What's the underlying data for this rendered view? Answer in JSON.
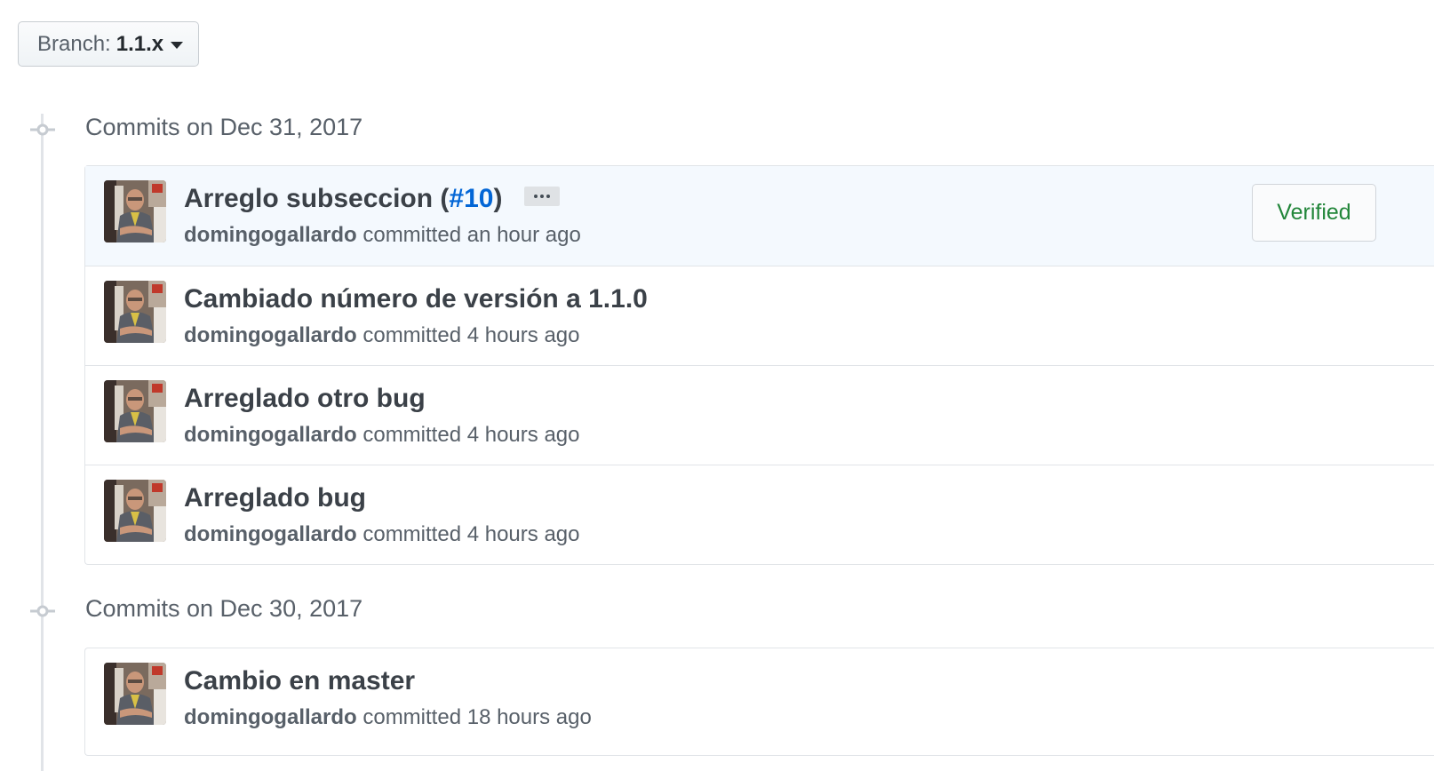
{
  "branch": {
    "prefix": "Branch:",
    "name": "1.1.x"
  },
  "groups": [
    {
      "title": "Commits on Dec 31, 2017",
      "commits": [
        {
          "title": "Arreglo subseccion (",
          "pr": "#10",
          "title_suffix": ")",
          "author": "domingogallardo",
          "action": "committed",
          "time": "an hour ago",
          "verified": "Verified"
        },
        {
          "title": "Cambiado número de versión a 1.1.0",
          "author": "domingogallardo",
          "action": "committed",
          "time": "4 hours ago"
        },
        {
          "title": "Arreglado otro bug",
          "author": "domingogallardo",
          "action": "committed",
          "time": "4 hours ago"
        },
        {
          "title": "Arreglado bug",
          "author": "domingogallardo",
          "action": "committed",
          "time": "4 hours ago"
        }
      ]
    },
    {
      "title": "Commits on Dec 30, 2017",
      "commits": [
        {
          "title": "Cambio en master",
          "author": "domingogallardo",
          "action": "committed",
          "time": "18 hours ago"
        }
      ]
    }
  ]
}
